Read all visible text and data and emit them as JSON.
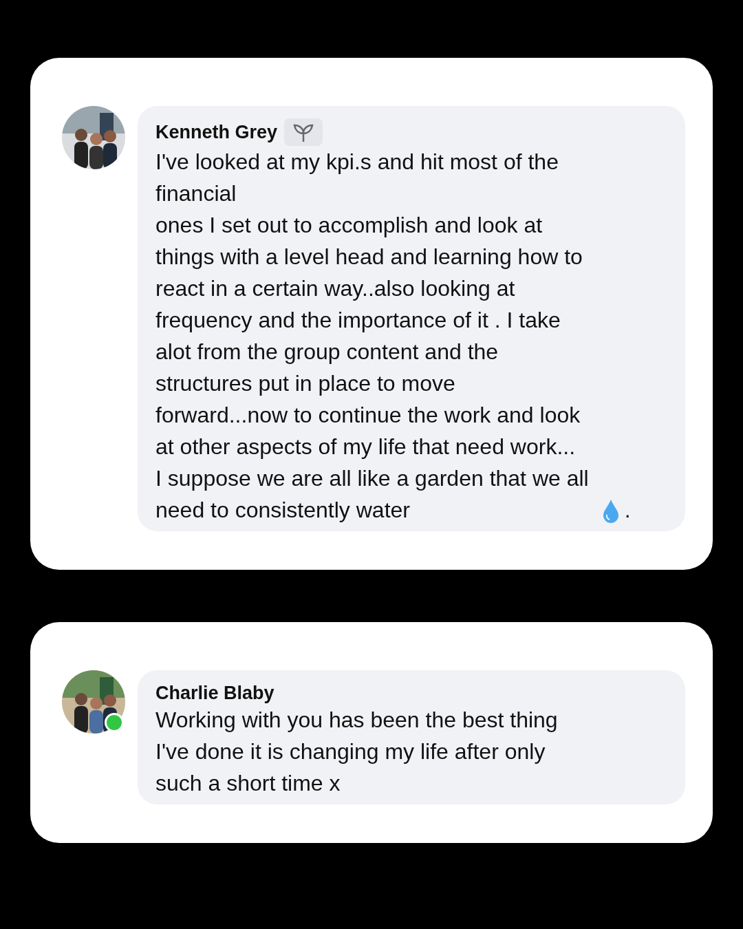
{
  "comments": [
    {
      "author": "Kenneth Grey",
      "badge": true,
      "online": false,
      "text": "I've looked at my kpi.s and hit most of the\nfinancial\nones I set out to accomplish and look at\nthings with a level head and learning how to\nreact in a certain way..also looking at\nfrequency and the importance of it . I take\nalot from the group content and the\nstructures put in place to move\nforward...now to continue the work and look\nat other aspects of my life that need work...\nI suppose we are all like a garden that we all\nneed to consistently water",
      "after_icon": "."
    },
    {
      "author": "Charlie Blaby",
      "badge": false,
      "online": true,
      "text": "Working with you has been the best thing\nI've done it is changing my life after only\nsuch a short time x"
    }
  ]
}
